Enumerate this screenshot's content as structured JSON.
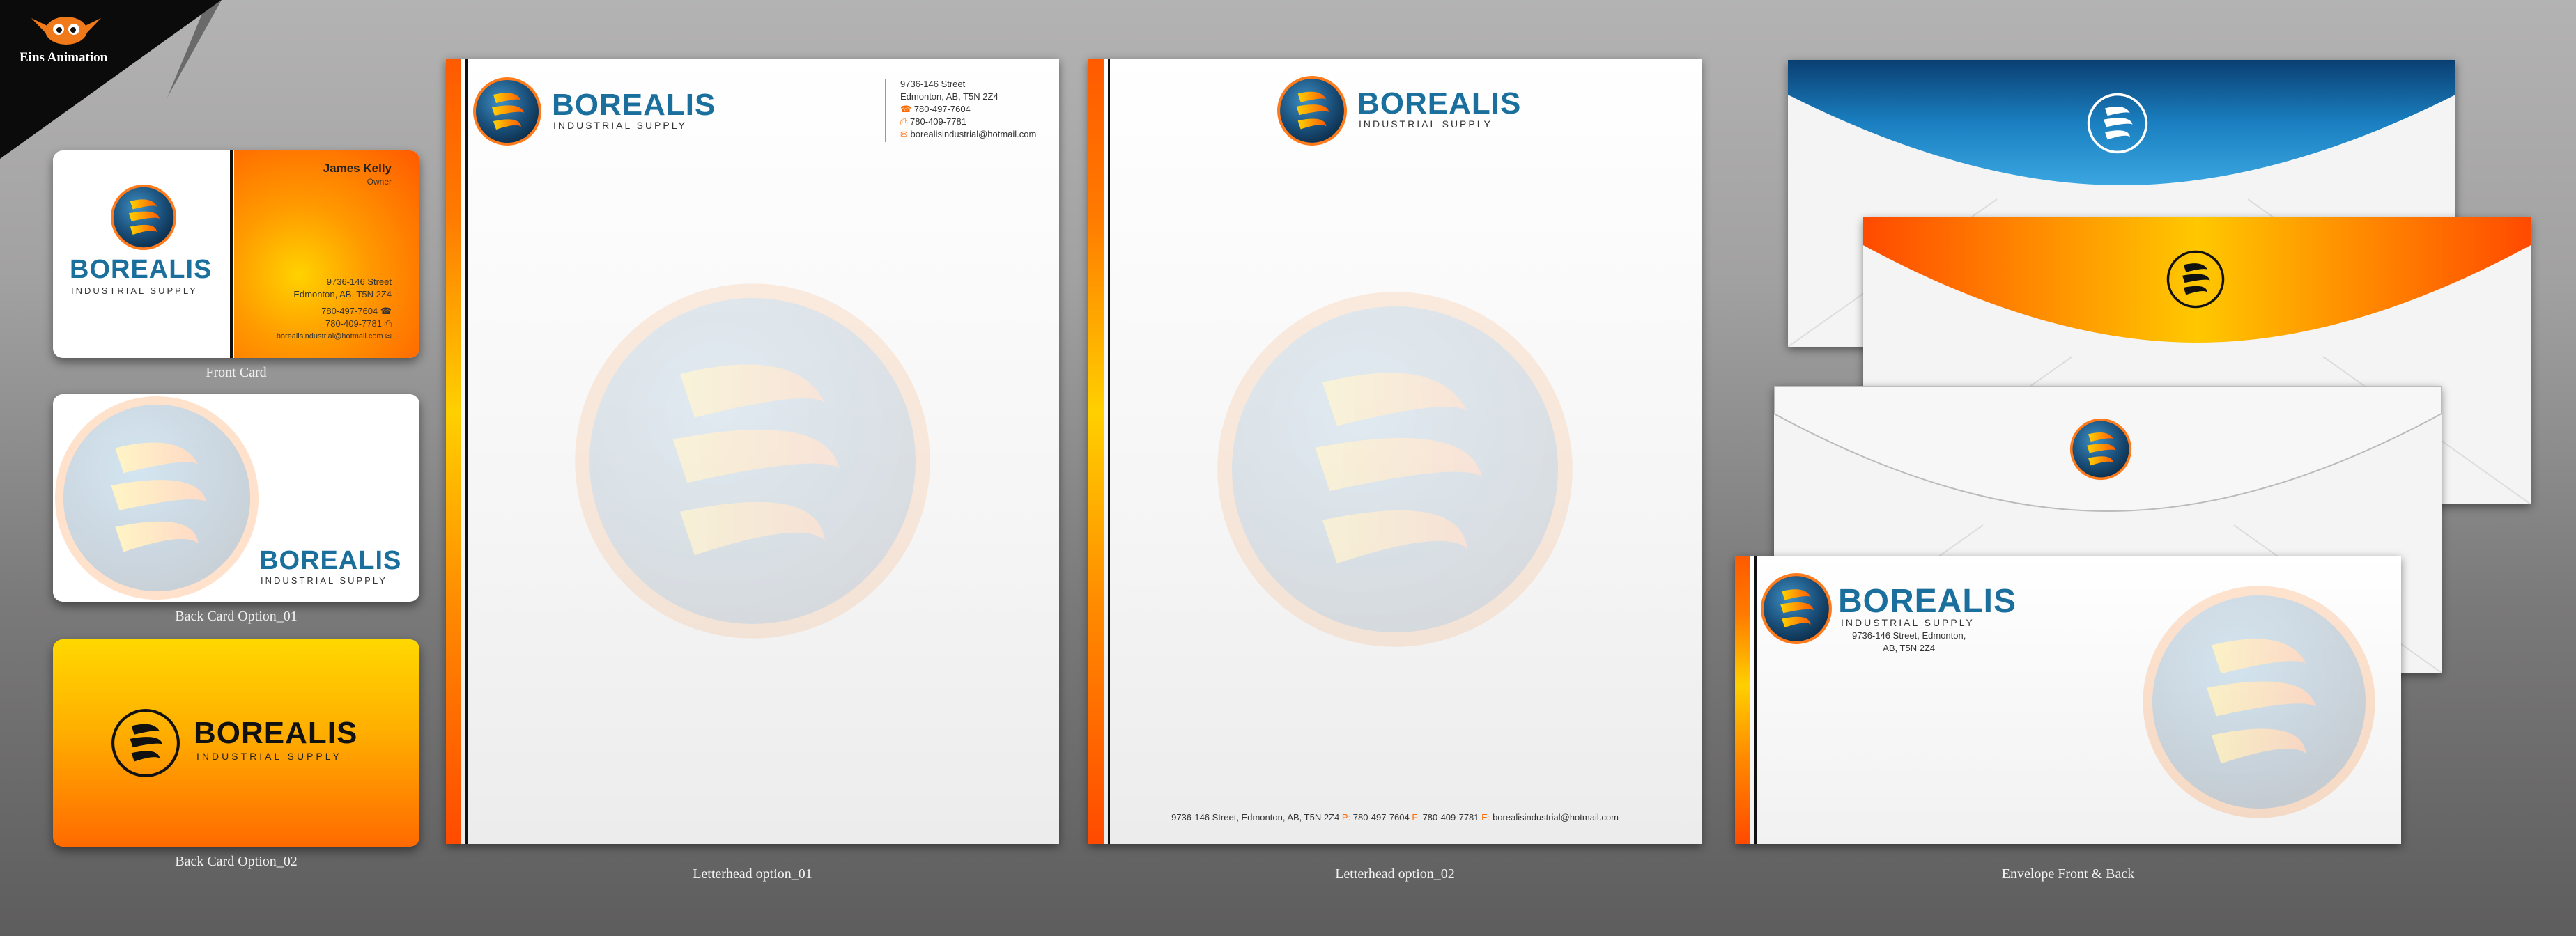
{
  "studio": {
    "name": "Eins Animation"
  },
  "brand": {
    "name": "BOREALIS",
    "tagline": "INDUSTRIAL SUPPLY"
  },
  "contact": {
    "person": "James Kelly",
    "role": "Owner",
    "street": "9736-146 Street",
    "city": "Edmonton, AB, T5N 2Z4",
    "phone": "780-497-7604",
    "fax": "780-409-7781",
    "email": "borealisindustrial@hotmail.com"
  },
  "letterhead2_footer": {
    "address": "9736-146 Street, Edmonton, AB, T5N 2Z4",
    "p_label": "P:",
    "p_value": "780-497-7604",
    "f_label": "F:",
    "f_value": "780-409-7781",
    "e_label": "E:",
    "e_value": "borealisindustrial@hotmail.com"
  },
  "envelope_address": {
    "line1": "9736-146 Street, Edmonton,",
    "line2": "AB, T5N 2Z4"
  },
  "captions": {
    "front_card": "Front Card",
    "back_card_1": "Back Card Option_01",
    "back_card_2": "Back Card Option_02",
    "letterhead_1": "Letterhead option_01",
    "letterhead_2": "Letterhead option_02",
    "envelope": "Envelope Front & Back"
  },
  "colors": {
    "blue": "#1a6f9d",
    "orange": "#ff6a00",
    "yellow": "#ffd200",
    "dark": "#1b1b1b"
  }
}
